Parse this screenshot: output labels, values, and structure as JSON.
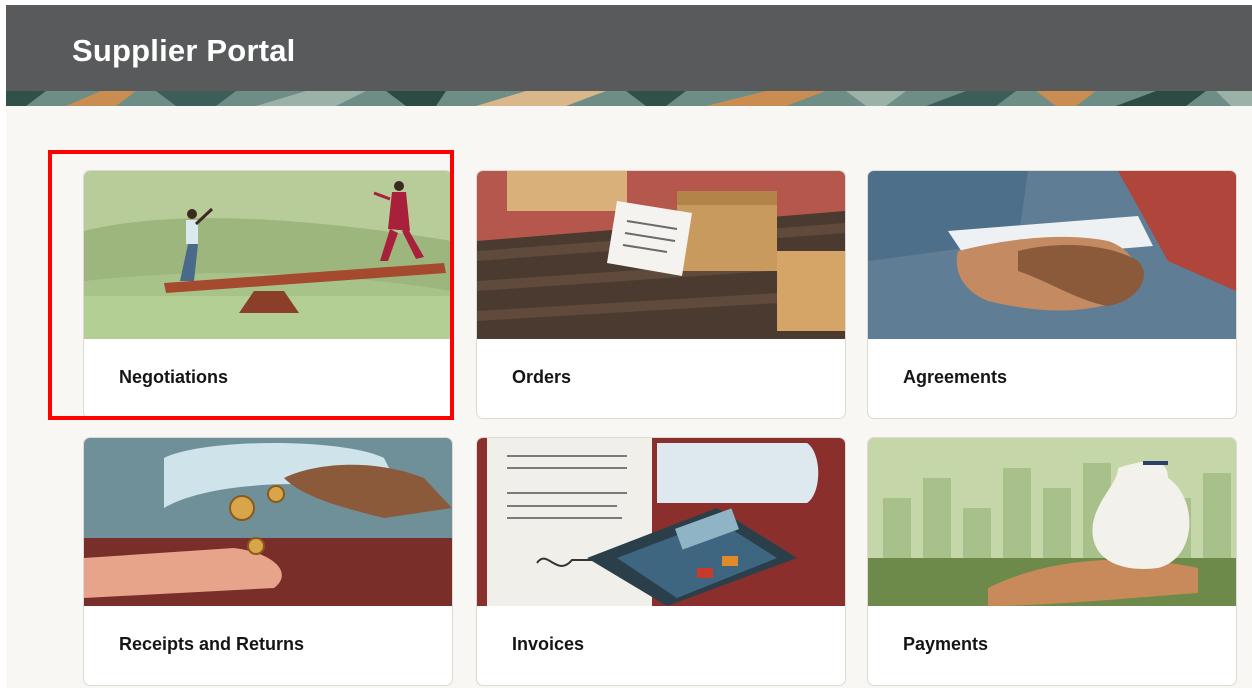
{
  "header": {
    "title": "Supplier Portal"
  },
  "tiles": [
    {
      "label": "Negotiations"
    },
    {
      "label": "Orders"
    },
    {
      "label": "Agreements"
    },
    {
      "label": "Receipts and Returns"
    },
    {
      "label": "Invoices"
    },
    {
      "label": "Payments"
    }
  ],
  "colors": {
    "header_bg": "#595a5c",
    "page_bg": "#f8f7f4",
    "highlight_border": "#ff0000"
  },
  "icons": {
    "negotiations": "seesaw-illustration",
    "orders": "boxes-conveyor-illustration",
    "agreements": "handshake-illustration",
    "receipts_and_returns": "coins-hands-illustration",
    "invoices": "calculator-receipt-illustration",
    "payments": "money-bag-illustration"
  }
}
